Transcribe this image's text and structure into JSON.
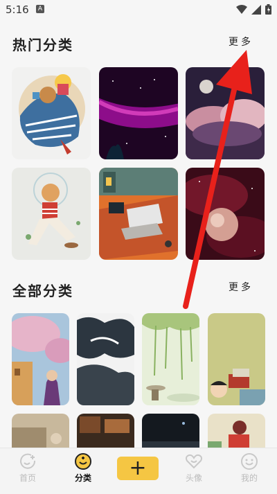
{
  "status": {
    "time": "5:16",
    "notif": "A"
  },
  "hot": {
    "title": "热门分类",
    "more": "更多"
  },
  "all": {
    "title": "全部分类",
    "more": "更多"
  },
  "nav": {
    "home": "首页",
    "category": "分类",
    "add": "+",
    "avatar": "头像",
    "mine": "我的"
  },
  "colors": {
    "accent": "#f5c643",
    "annotation_arrow": "#e8211b"
  }
}
